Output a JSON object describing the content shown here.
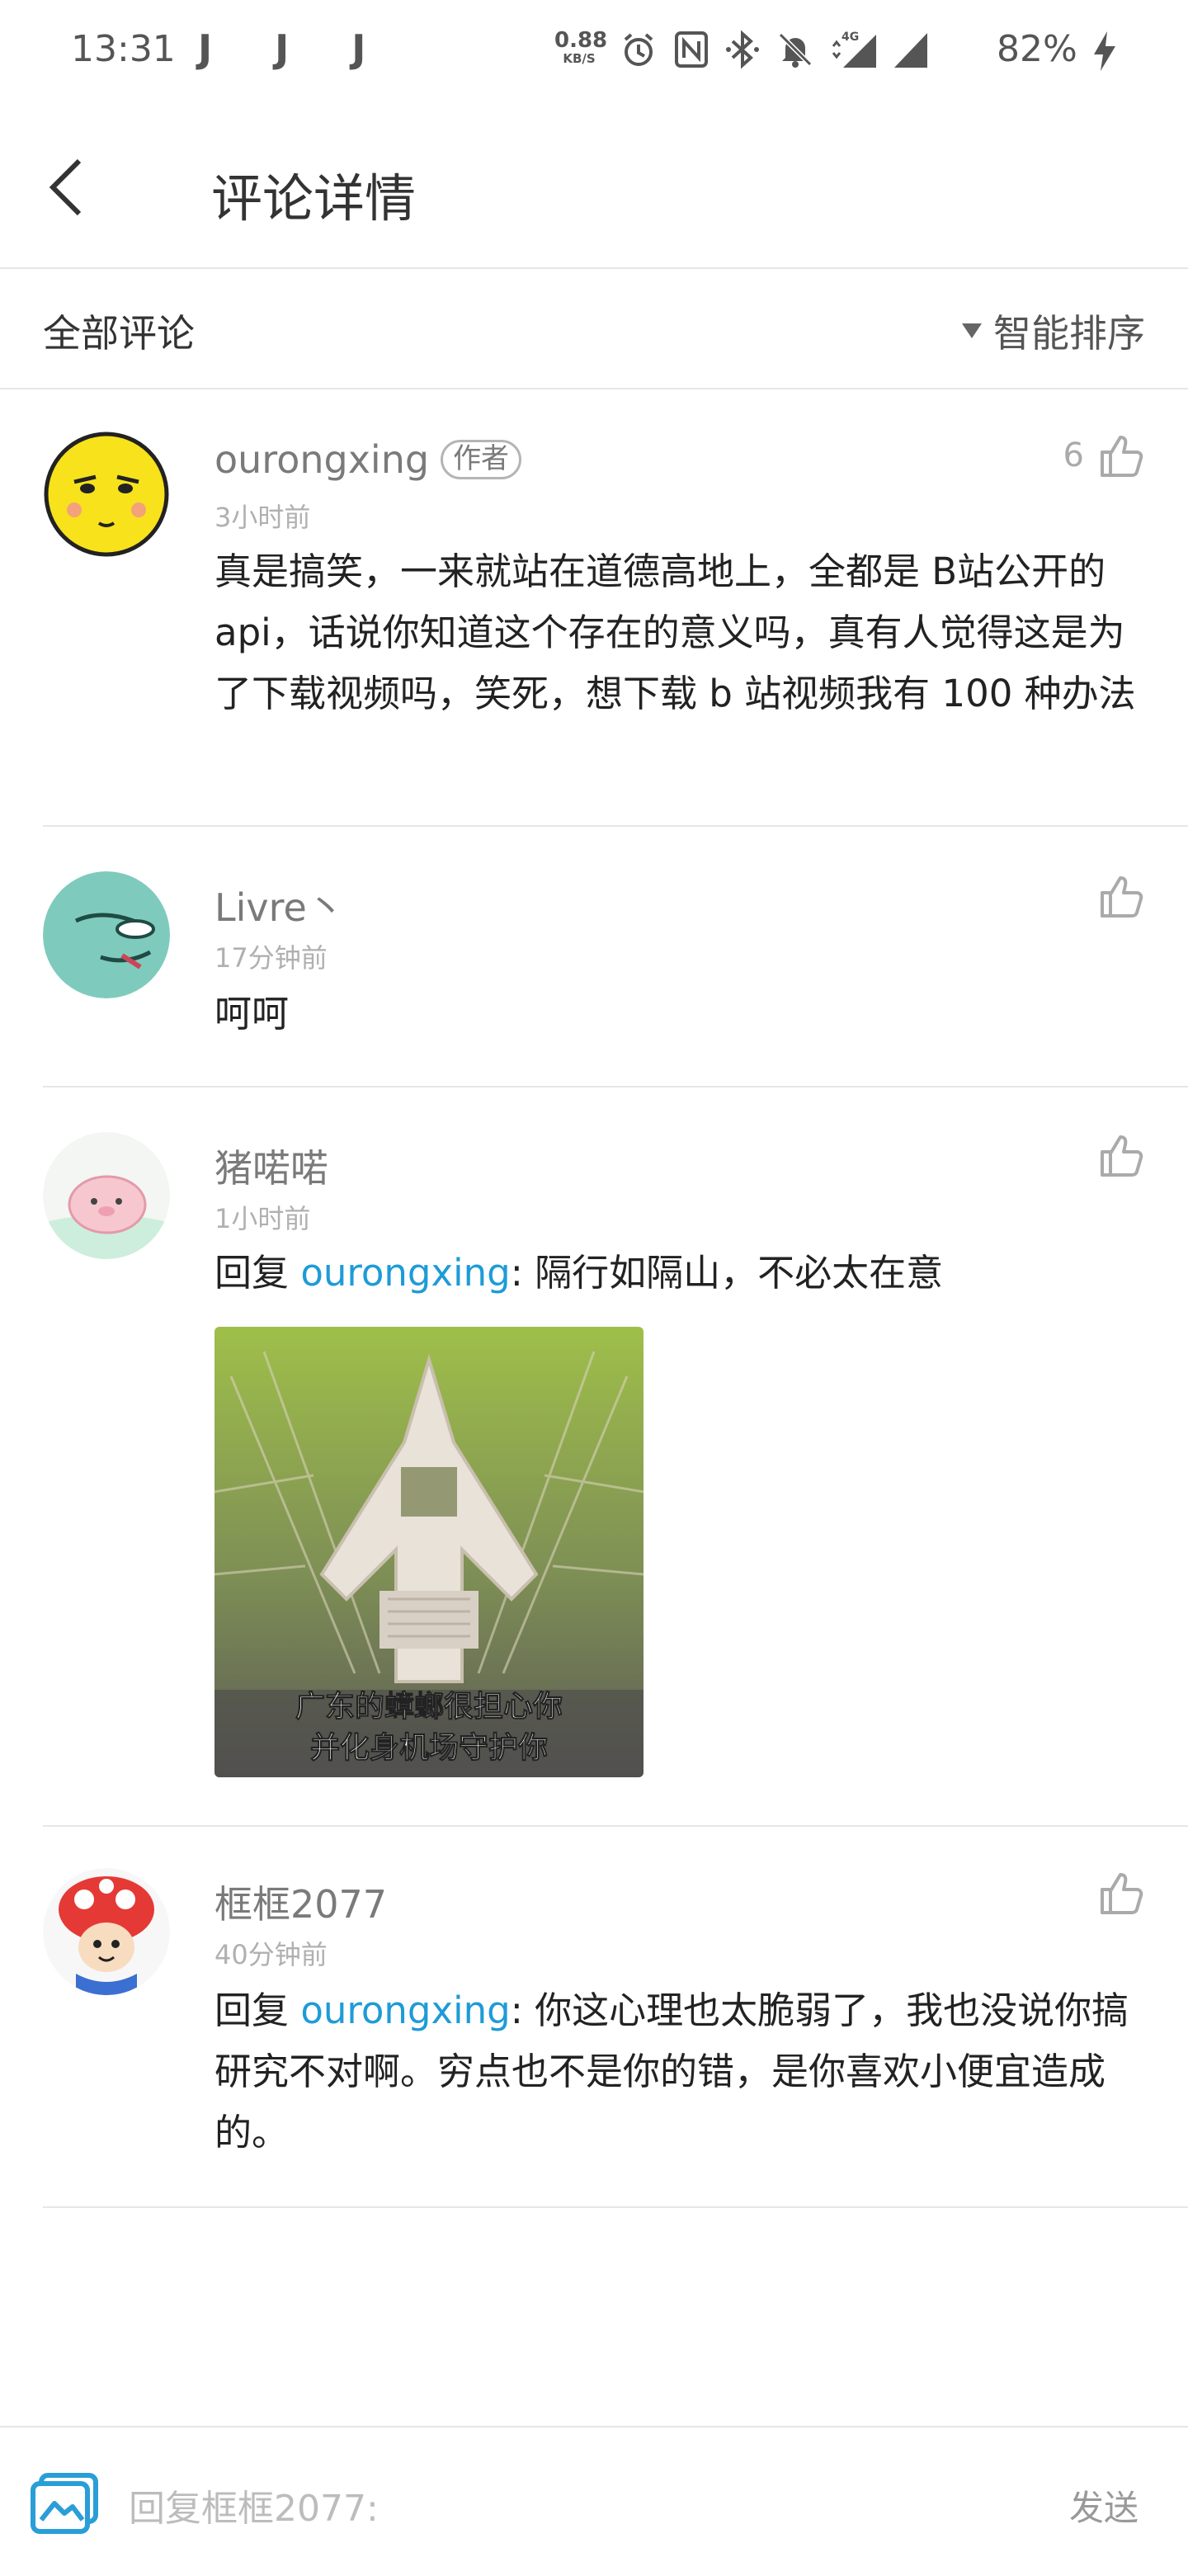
{
  "status_bar": {
    "time": "13:31",
    "notification_icons": "J J J",
    "net_speed_value": "0.88",
    "net_speed_unit": "KB/S",
    "network": "4G",
    "battery": "82%"
  },
  "app_bar": {
    "title": "评论详情"
  },
  "sort_bar": {
    "left_label": "全部评论",
    "sort_label": "智能排序"
  },
  "comments": [
    {
      "user": "ourongxing",
      "badge": "作者",
      "time": "3小时前",
      "like_count": "6",
      "text": "真是搞笑，一来就站在道德高地上，全都是 B站公开的 api，话说你知道这个存在的意义吗，真有人觉得这是为了下载视频吗，笑死，想下载 b 站视频我有 100 种办法"
    },
    {
      "user": "Livre丶",
      "time": "17分钟前",
      "text": "呵呵"
    },
    {
      "user": "猪喏喏",
      "time": "1小时前",
      "reply_prefix": "回复 ",
      "reply_to": "ourongxing",
      "text": ": 隔行如隔山，不必太在意",
      "image_caption_line1": "广东的蟑螂很担心你",
      "image_caption_line2": "并化身机场守护你"
    },
    {
      "user": "框框2077",
      "time": "40分钟前",
      "reply_prefix": "回复 ",
      "reply_to": "ourongxing",
      "text": ": 你这心理也太脆弱了，我也没说你搞研究不对啊。穷点也不是你的错，是你喜欢小便宜造成的。"
    }
  ],
  "bottom_bar": {
    "reply_placeholder": "回复框框2077:",
    "send_label": "发送"
  },
  "colors": {
    "link": "#1e9bd7",
    "accent_icon": "#2a9ed6",
    "text_primary": "#222222",
    "text_muted": "#7a7a7a"
  }
}
